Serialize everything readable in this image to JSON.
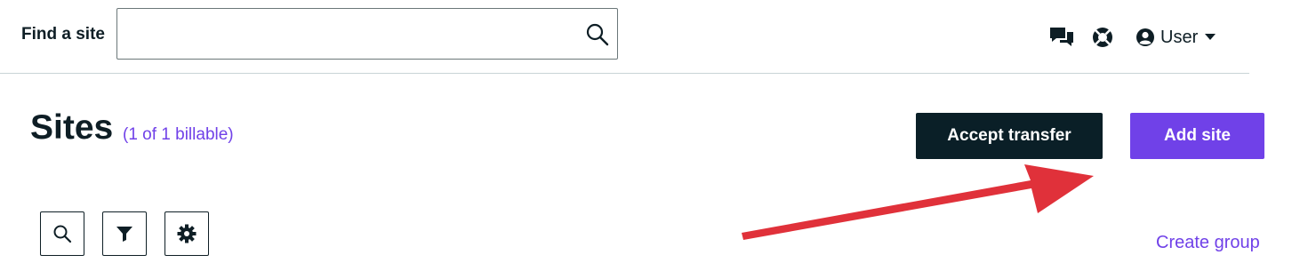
{
  "header": {
    "find_label": "Find a site",
    "search": {
      "value": "",
      "placeholder": ""
    },
    "icons": [
      "chat-icon",
      "help-lifebuoy-icon",
      "user-avatar-icon"
    ],
    "user_label": "User"
  },
  "main": {
    "title": "Sites",
    "billable": "(1 of 1 billable)",
    "accept_transfer_label": "Accept transfer",
    "add_site_label": "Add site",
    "create_group_label": "Create group",
    "toolbar_icons": [
      "search-icon",
      "filter-icon",
      "gear-icon"
    ]
  },
  "colors": {
    "accent_purple": "#7041e8",
    "dark_button": "#0a1f27",
    "annotation_arrow": "#e0313a",
    "text": "#0e1e25"
  }
}
